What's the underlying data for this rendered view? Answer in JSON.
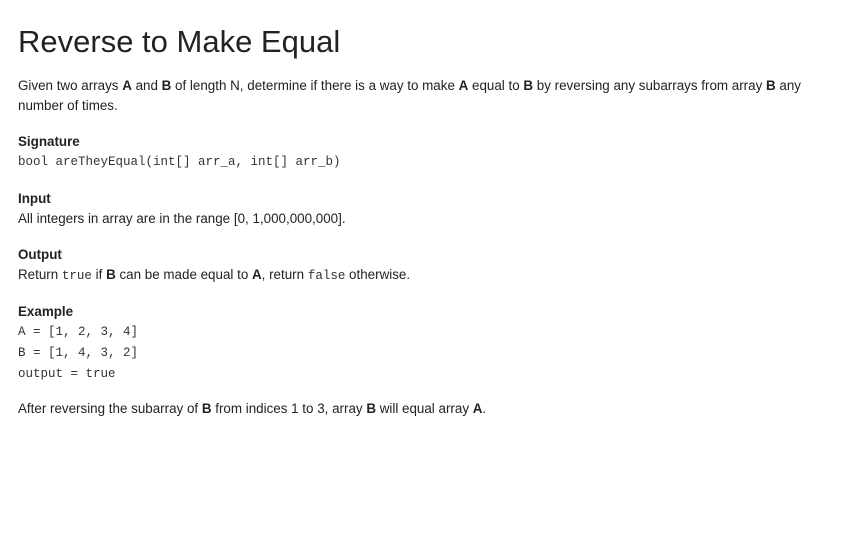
{
  "title": "Reverse to Make Equal",
  "intro": {
    "t1": "Given two arrays ",
    "a": "A",
    "t2": " and ",
    "b": "B",
    "t3": " of length N, determine if there is a way to make ",
    "a2": "A",
    "t4": " equal to ",
    "b2": "B",
    "t5": " by reversing any subarrays from array ",
    "b3": "B",
    "t6": " any number of times."
  },
  "signature": {
    "heading": "Signature",
    "code": "bool areTheyEqual(int[] arr_a, int[] arr_b)"
  },
  "input": {
    "heading": "Input",
    "text": "All integers in array are in the range [0, 1,000,000,000]."
  },
  "output": {
    "heading": "Output",
    "t1": "Return ",
    "code_true": "true",
    "t2": " if ",
    "b": "B",
    "t3": " can be made equal to ",
    "a": "A",
    "t4": ", return ",
    "code_false": "false",
    "t5": " otherwise."
  },
  "example": {
    "heading": "Example",
    "lines": [
      "A = [1, 2, 3, 4]",
      "B = [1, 4, 3, 2]",
      "output = true"
    ],
    "explanation": {
      "t1": "After reversing the subarray of ",
      "b": "B",
      "t2": " from indices 1 to 3, array ",
      "b2": "B",
      "t3": " will equal array ",
      "a": "A",
      "t4": "."
    }
  }
}
